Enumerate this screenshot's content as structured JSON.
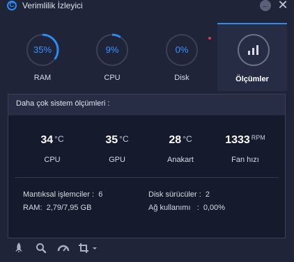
{
  "app": {
    "title": "Verimlilik İzleyici",
    "logo_letter": "C"
  },
  "colors": {
    "accent": "#2e8cf0",
    "background": "#1f2438",
    "panel": "#151a2c",
    "alert": "#e63946"
  },
  "tabs": [
    {
      "label": "RAM",
      "value": "35%",
      "percent": 35
    },
    {
      "label": "CPU",
      "value": "9%",
      "percent": 9
    },
    {
      "label": "Disk",
      "value": "0%",
      "percent": 0
    },
    {
      "label": "Ölçümler",
      "active": true,
      "icon": "bar-chart-icon"
    }
  ],
  "panel": {
    "header": "Daha çok sistem ölçümleri :",
    "metrics": [
      {
        "value": "34",
        "unit": "°C",
        "label": "CPU"
      },
      {
        "value": "35",
        "unit": "°C",
        "label": "GPU"
      },
      {
        "value": "28",
        "unit": "°C",
        "label": "Anakart"
      },
      {
        "value": "1333",
        "unit": "RPM",
        "label": "Fan hızı"
      }
    ],
    "info": {
      "logical_processors": "Mantıksal işlemciler :  6",
      "ram": "RAM:  2,79/7,95 GB",
      "disk_drivers": "Disk sürücüler :  2",
      "network_usage": "Ağ kullanımı   :  0,00%"
    }
  },
  "toolbar": {
    "icons": [
      "rocket-icon",
      "search-icon",
      "speedometer-icon",
      "crop-icon"
    ],
    "dropdown_icon": "chevron-down-icon"
  },
  "window_controls": {
    "back_icon": "arrow-left-icon",
    "close_icon": "close-icon"
  }
}
